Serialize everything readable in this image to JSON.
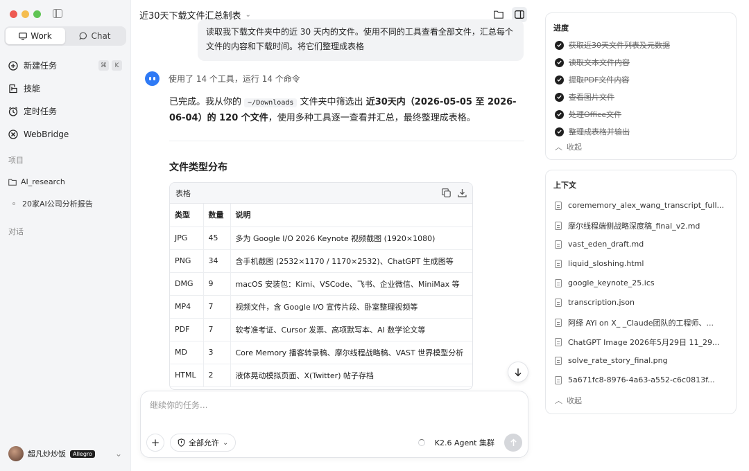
{
  "sidebar": {
    "modes": [
      {
        "label": "Work",
        "active": true
      },
      {
        "label": "Chat",
        "active": false
      }
    ],
    "nav": [
      {
        "label": "新建任务",
        "icon": "plus-circle-icon",
        "shortcut": [
          "⌘",
          "K"
        ]
      },
      {
        "label": "技能",
        "icon": "skills-icon"
      },
      {
        "label": "定时任务",
        "icon": "clock-icon"
      },
      {
        "label": "WebBridge",
        "icon": "webbridge-icon"
      }
    ],
    "projects_label": "项目",
    "projects": [
      {
        "label": "AI_research",
        "icon": "folder-icon"
      },
      {
        "label": "20家AI公司分析报告"
      }
    ],
    "conversations_label": "对话",
    "user": {
      "name": "超凡炒炒饭",
      "plan": "Allegro"
    }
  },
  "main": {
    "title": "近30天下载文件汇总制表",
    "user_message": "读取我下载文件夹中的近 30 天内的文件。使用不同的工具查看全部文件，汇总每个文件的内容和下载时间。将它们整理成表格",
    "tool_summary": "使用了 14 个工具，运行 14 个命令",
    "answer": {
      "p1": "已完成。我从你的",
      "path": "~/Downloads",
      "p2": "文件夹中筛选出",
      "bold": "近30天内（2026-05-05 至 2026-06-04）的 120 个文件",
      "p3": "，使用多种工具逐一查看并汇总，最终整理成表格。"
    },
    "section_title": "文件类型分布",
    "table": {
      "label": "表格",
      "headers": [
        "类型",
        "数量",
        "说明"
      ],
      "rows": [
        [
          "JPG",
          "45",
          "多为 Google I/O 2026 Keynote 视频截图 (1920×1080)"
        ],
        [
          "PNG",
          "34",
          "含手机截图 (2532×1170 / 1170×2532)、ChatGPT 生成图等"
        ],
        [
          "DMG",
          "9",
          "macOS 安装包：Kimi、VSCode、飞书、企业微信、MiniMax 等"
        ],
        [
          "MP4",
          "7",
          "视频文件，含 Google I/O 宣传片段、卧室整理视频等"
        ],
        [
          "PDF",
          "7",
          "软考准考证、Cursor 发票、高项默写本、AI 数学论文等"
        ],
        [
          "MD",
          "3",
          "Core Memory 播客转录稿、摩尔线程战略稿、VAST 世界模型分析"
        ],
        [
          "HTML",
          "2",
          "液体晃动模拟页面、X(Twitter) 帖子存档"
        ]
      ]
    },
    "composer": {
      "placeholder": "继续你的任务...",
      "permission": "全部允许",
      "model": "K2.6 Agent 集群"
    }
  },
  "right": {
    "progress_title": "进度",
    "todos": [
      "获取近30天文件列表及元数据",
      "读取文本文件内容",
      "提取PDF文件内容",
      "查看图片文件",
      "处理Office文件",
      "整理成表格并输出"
    ],
    "collapse_label": "收起",
    "context_title": "上下文",
    "files": [
      "corememory_alex_wang_transcript_full...",
      "摩尔线程端侧战略深度稿_final_v2.md",
      "vast_eden_draft.md",
      "liquid_sloshing.html",
      "google_keynote_25.ics",
      "transcription.json",
      "阿绎 AYi on X_ _Claude团队的工程师、...",
      "ChatGPT Image 2026年5月29日 11_29...",
      "solve_rate_story_final.png",
      "5a671fc8-8976-4a63-a552-c6c0813f..."
    ]
  }
}
